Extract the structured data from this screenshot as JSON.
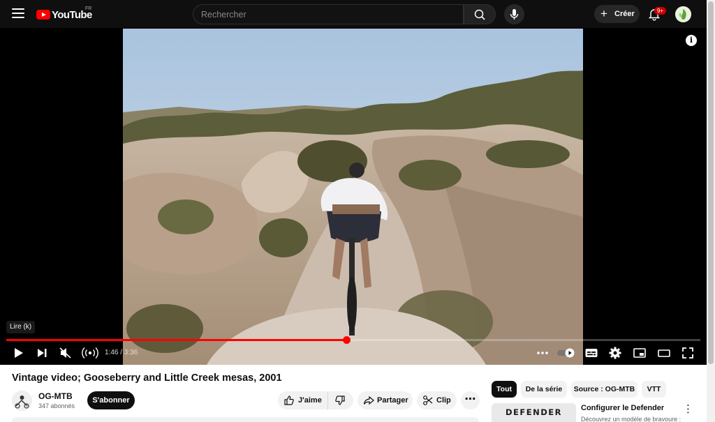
{
  "header": {
    "logo_text": "YouTube",
    "country_code": "FR",
    "search_placeholder": "Rechercher",
    "create_label": "Créer",
    "notifications_badge": "9+"
  },
  "player": {
    "tooltip": "Lire (k)",
    "current_time": "1:46",
    "duration": "3:36",
    "time_display": "1:46 / 3:36",
    "progress": 0.49,
    "info_icon": "i"
  },
  "video": {
    "title": "Vintage video; Gooseberry and Little Creek mesas, 2001",
    "channel_name": "OG-MTB",
    "subscribers": "347 abonnés",
    "subscribe_label": "S'abonner",
    "like_label": "J'aime",
    "share_label": "Partager",
    "clip_label": "Clip"
  },
  "sidebar": {
    "chips": [
      {
        "label": "Tout",
        "active": true
      },
      {
        "label": "De la série",
        "active": false
      },
      {
        "label": "Source : OG-MTB",
        "active": false
      },
      {
        "label": "VTT",
        "active": false
      }
    ],
    "ad": {
      "thumb_text": "DEFENDER",
      "title": "Configurer le Defender",
      "description": "Découvrez un modèle de bravoure :"
    }
  },
  "colors": {
    "accent": "#ff0000",
    "topbar": "#0f0f0f",
    "pill_bg": "#f2f2f2"
  }
}
